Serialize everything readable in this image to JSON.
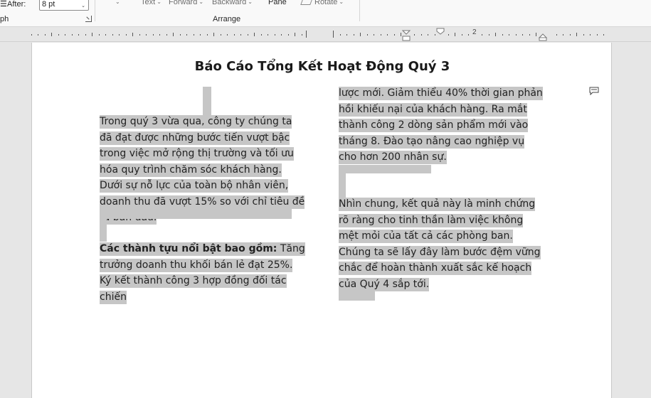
{
  "ribbon": {
    "spacing_after_label": "After:",
    "spacing_after_value": "8 pt",
    "paragraph_group_label": "ph",
    "wrap_text_label": "Text",
    "bring_forward_label": "Forward",
    "send_backward_label": "Backward",
    "selection_pane_label": "Pane",
    "rotate_label": "Rotate",
    "arrange_group_label": "Arrange"
  },
  "ruler": {
    "number_label": "2"
  },
  "document": {
    "title": "Báo Cáo Tổng Kết Hoạt Động Quý 3",
    "paragraph1": "Trong quý 3 vừa qua, công ty chúng ta đã đạt được những bước tiến vượt bậc trong việc mở rộng thị trường và tối ưu hóa quy trình chăm sóc khách hàng. Dưới sự nỗ lực của toàn bộ nhân viên, doanh thu đã vượt 15% so với chỉ tiêu đề ra ban đầu.",
    "achievements_heading": "Các thành tựu nổi bật bao gồm:",
    "achievements_text_col1": " Tăng trưởng doanh thu khối bán lẻ đạt 25%. Ký kết thành công 3 hợp đồng đối tác chiến",
    "achievements_text_col2": "lược mới. Giảm thiểu 40% thời gian phản hồi khiếu nại của khách hàng. Ra mắt thành công 2 dòng sản phẩm mới vào tháng 8. Đào tạo nâng cao nghiệp vụ cho hơn 200 nhân sự.",
    "conclusion": "Nhìn chung, kết quả này là minh chứng rõ ràng cho tinh thần làm việc không mệt mỏi của tất cả các phòng ban. Chúng ta sẽ lấy đây làm bước đệm vững chắc để hoàn thành xuất sắc kế hoạch của Quý 4 sắp tới."
  },
  "colors": {
    "selection": "#c6c6c6",
    "page": "#ffffff",
    "canvas": "#e6e6e6"
  }
}
